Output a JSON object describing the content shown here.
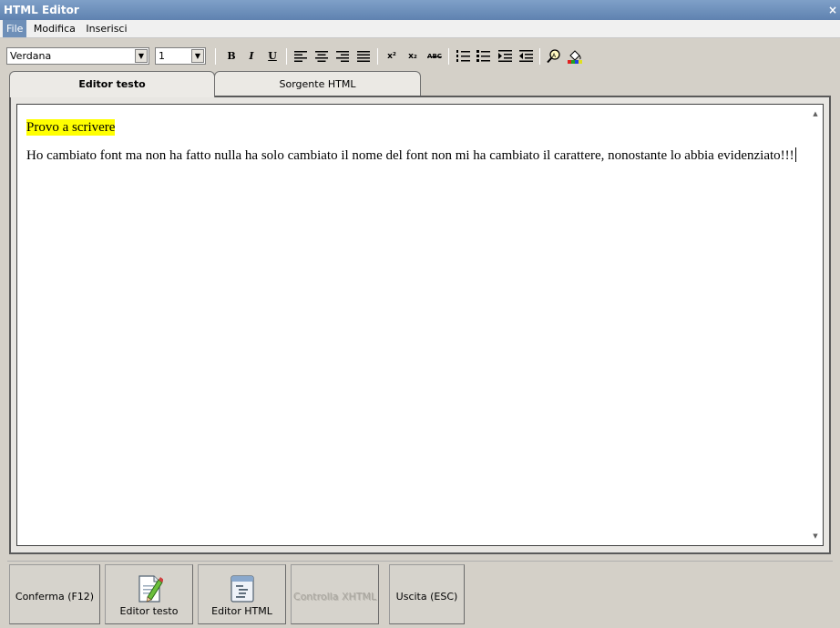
{
  "window": {
    "title": "HTML Editor",
    "close_glyph": "×"
  },
  "menu": [
    {
      "label": "File",
      "active": true
    },
    {
      "label": "Modifica",
      "active": false
    },
    {
      "label": "Inserisci",
      "active": false
    }
  ],
  "toolbar": {
    "font_value": "Verdana",
    "size_value": "1",
    "bold": "B",
    "italic": "I",
    "underline": "U",
    "superscript": "x²",
    "subscript": "x₂",
    "spellcheck": "ABC"
  },
  "tabs": [
    {
      "label": "Editor testo",
      "active": true
    },
    {
      "label": "Sorgente HTML",
      "active": false
    }
  ],
  "editor": {
    "line1": "Provo a scrivere",
    "line2": "Ho cambiato font ma non ha fatto nulla ha solo cambiato il nome del font non mi ha cambiato il carattere, nonostante lo abbia evidenziato!!!",
    "highlight_color": "#ffff00"
  },
  "bottom_buttons": {
    "confirm": "Conferma (F12)",
    "text_editor": "Editor testo",
    "html_editor": "Editor HTML",
    "check_xhtml": "Controlla XHTML",
    "exit": "Uscita (ESC)"
  },
  "colors": {
    "title_bar": "#6f91bc",
    "menu_active": "#6e8fb8",
    "window_bg": "#d4d0c8"
  }
}
